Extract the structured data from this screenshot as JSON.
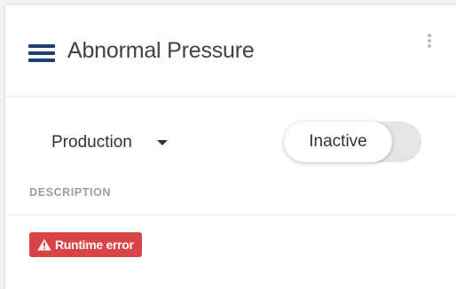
{
  "header": {
    "menu_icon": "hamburger-menu-icon",
    "title": "Abnormal Pressure",
    "more_icon": "more-vertical-icon"
  },
  "controls": {
    "environment": "Production",
    "environment_caret_icon": "caret-down-icon",
    "status_toggle_label": "Inactive",
    "status_toggle_state": "off"
  },
  "details": {
    "description_label": "DESCRIPTION",
    "badge_icon": "warning-triangle-icon",
    "badge_label": "Runtime error",
    "badge_color": "#d94346"
  },
  "colors": {
    "accent": "#1e3f74",
    "title_text": "#3e4247",
    "muted_label": "#9a9ea3",
    "error": "#d94346"
  }
}
